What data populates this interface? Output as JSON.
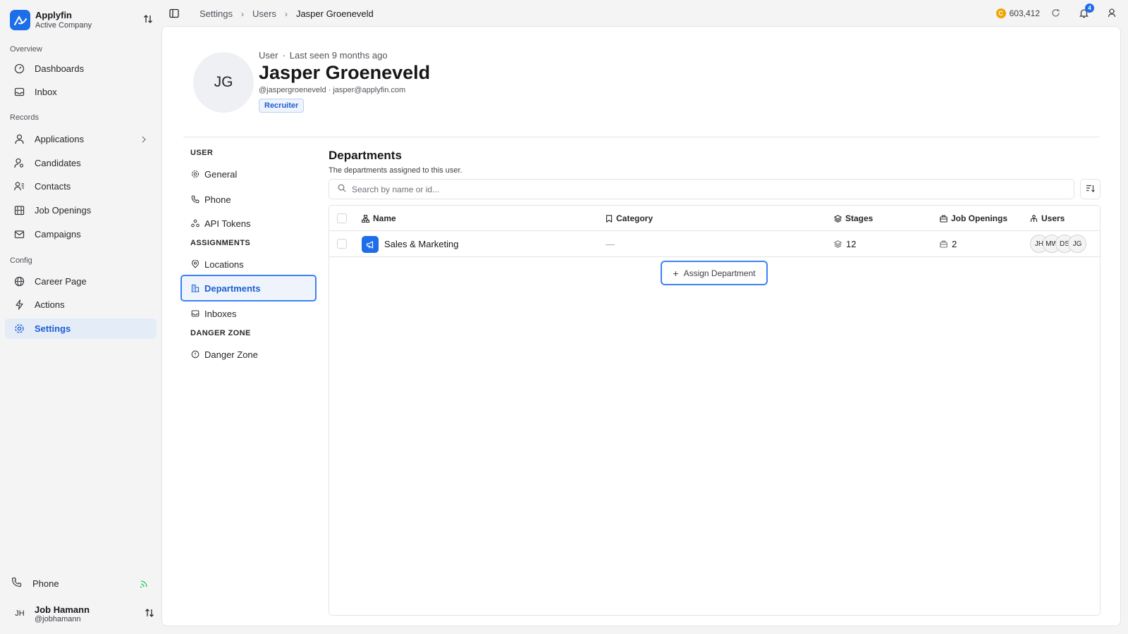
{
  "brand": {
    "name": "Applyfin",
    "sub": "Active Company"
  },
  "sidebar": {
    "sections": {
      "overview": "Overview",
      "records": "Records",
      "config": "Config"
    },
    "items": [
      {
        "label": "Dashboards",
        "icon": "gauge-icon"
      },
      {
        "label": "Inbox",
        "icon": "inbox-icon"
      },
      {
        "label": "Applications",
        "icon": "user-icon"
      },
      {
        "label": "Candidates",
        "icon": "user-search-icon"
      },
      {
        "label": "Contacts",
        "icon": "contacts-icon"
      },
      {
        "label": "Job Openings",
        "icon": "building-icon"
      },
      {
        "label": "Campaigns",
        "icon": "mail-icon"
      },
      {
        "label": "Career Page",
        "icon": "globe-icon"
      },
      {
        "label": "Actions",
        "icon": "bolt-icon"
      },
      {
        "label": "Settings",
        "icon": "gear-icon",
        "active": true
      }
    ],
    "phone": "Phone",
    "user": {
      "initials": "JH",
      "name": "Job Hamann",
      "handle": "@jobhamann"
    }
  },
  "topbar": {
    "breadcrumbs": [
      "Settings",
      "Users",
      "Jasper Groeneveld"
    ],
    "credits": "603,412",
    "coin": "C",
    "notifications": "4"
  },
  "profile": {
    "initials": "JG",
    "type": "User",
    "last_seen": "Last seen 9 months ago",
    "name": "Jasper Groeneveld",
    "handle_email": "@jaspergroeneveld · jasper@applyfin.com",
    "role": "Recruiter"
  },
  "settings_nav": {
    "user_label": "USER",
    "assignments_label": "ASSIGNMENTS",
    "danger_label": "DANGER ZONE",
    "items": {
      "general": "General",
      "phone": "Phone",
      "api_tokens": "API Tokens",
      "locations": "Locations",
      "departments": "Departments",
      "inboxes": "Inboxes",
      "danger_zone": "Danger Zone"
    }
  },
  "departments": {
    "title": "Departments",
    "subtitle": "The departments assigned to this user.",
    "search_placeholder": "Search by name or id...",
    "columns": {
      "name": "Name",
      "category": "Category",
      "stages": "Stages",
      "job_openings": "Job Openings",
      "users": "Users"
    },
    "rows": [
      {
        "name": "Sales & Marketing",
        "category": "—",
        "stages": "12",
        "job_openings": "2",
        "users": [
          "JH",
          "MW",
          "DS",
          "JG"
        ]
      }
    ],
    "assign_button": "Assign Department"
  },
  "colors": {
    "accent": "#1d6ee8",
    "active_bg": "#e4ecf8",
    "coin": "#f0a500"
  }
}
